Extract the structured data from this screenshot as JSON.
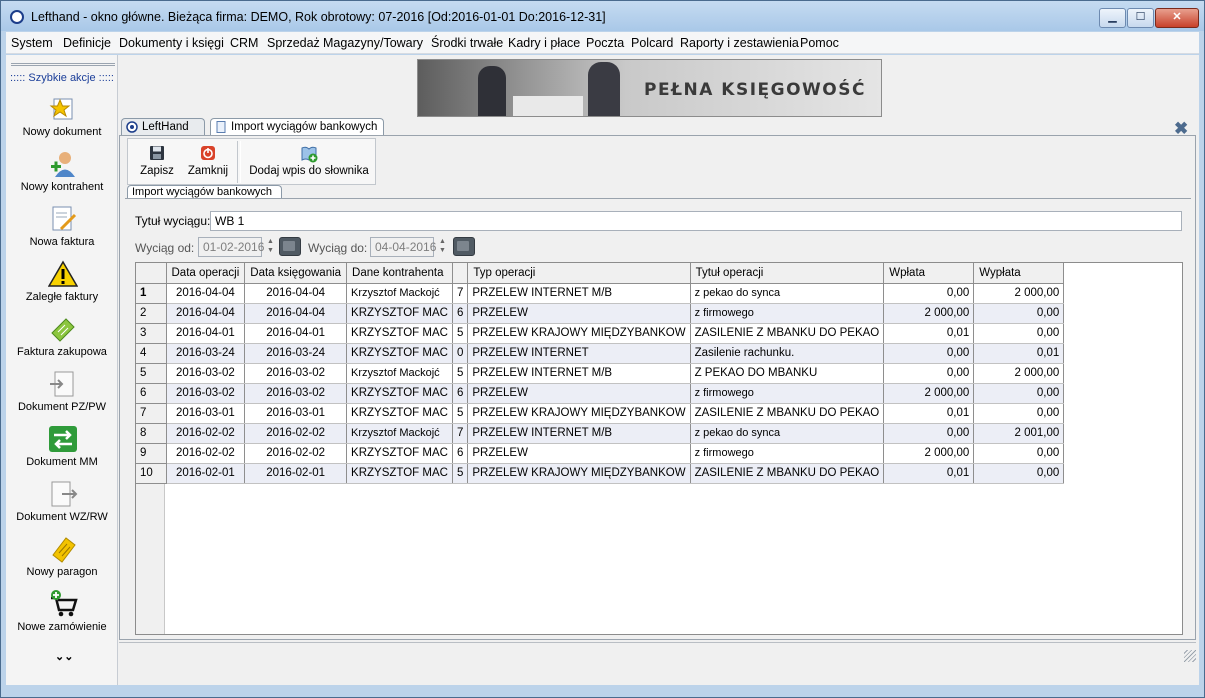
{
  "window": {
    "title": "Lefthand - okno główne. Bieżąca firma: DEMO, Rok obrotowy: 07-2016 [Od:2016-01-01 Do:2016-12-31]",
    "buttons": {
      "minimize": "▁",
      "maximize": "☐",
      "close": "✕"
    }
  },
  "menu": [
    "System",
    "Definicje",
    "Dokumenty i księgi",
    "CRM",
    "Sprzedaż",
    "Magazyny/Towary",
    "Środki trwałe",
    "Kadry i płace",
    "Poczta",
    "Polcard",
    "Raporty i zestawienia",
    "Pomoc"
  ],
  "sidebar": {
    "header": "::::: Szybkie akcje :::::",
    "items": [
      {
        "label": "Nowy dokument",
        "icon": "star-document-icon"
      },
      {
        "label": "Nowy kontrahent",
        "icon": "person-add-icon"
      },
      {
        "label": "Nowa faktura",
        "icon": "invoice-pencil-icon"
      },
      {
        "label": "Zaległe faktury",
        "icon": "warning-icon"
      },
      {
        "label": "Faktura zakupowa",
        "icon": "purchase-invoice-icon"
      },
      {
        "label": "Dokument PZ/PW",
        "icon": "document-in-icon"
      },
      {
        "label": "Dokument MM",
        "icon": "transfer-arrows-icon"
      },
      {
        "label": "Dokument WZ/RW",
        "icon": "document-out-icon"
      },
      {
        "label": "Nowy paragon",
        "icon": "receipt-icon"
      },
      {
        "label": "Nowe zamówienie",
        "icon": "cart-add-icon"
      }
    ],
    "more": "⌄⌄"
  },
  "banner": {
    "title": "PEŁNA KSIĘGOWOŚĆ"
  },
  "tabs": [
    {
      "label": "LeftHand",
      "icon": "lefthand-logo-icon"
    },
    {
      "label": "Import wyciągów bankowych",
      "icon": "document-icon"
    }
  ],
  "close_tab": "✖",
  "toolbar": {
    "save": "Zapisz",
    "close": "Zamknij",
    "add_dict": "Dodaj wpis do słownika"
  },
  "subtab": "Import wyciągów bankowych",
  "form": {
    "title_label": "Tytuł wyciągu:",
    "title_value": "WB 1",
    "from_label": "Wyciąg od:",
    "from_value": "01-02-2016",
    "to_label": "Wyciąg do:",
    "to_value": "04-04-2016"
  },
  "table": {
    "columns": [
      "",
      "Data operacji",
      "Data księgowania",
      "Dane kontrahenta",
      "",
      "Typ operacji",
      "Tytuł operacji",
      "Wpłata",
      "Wypłata"
    ],
    "rows": [
      [
        "1",
        "2016-04-04",
        "2016-04-04",
        "Krzysztof Mackojć",
        "7",
        "PRZELEW INTERNET M/B",
        "z pekao do synca",
        "0,00",
        "2 000,00"
      ],
      [
        "2",
        "2016-04-04",
        "2016-04-04",
        "KRZYSZTOF MAC",
        "6",
        "PRZELEW",
        "z firmowego",
        "2 000,00",
        "0,00"
      ],
      [
        "3",
        "2016-04-01",
        "2016-04-01",
        "KRZYSZTOF MAC",
        "5",
        "PRZELEW KRAJOWY MIĘDZYBANKOW",
        "ZASILENIE Z MBANKU DO PEKAO",
        "0,01",
        "0,00"
      ],
      [
        "4",
        "2016-03-24",
        "2016-03-24",
        "KRZYSZTOF MAC",
        "0",
        "PRZELEW INTERNET",
        "Zasilenie rachunku.",
        "0,00",
        "0,01"
      ],
      [
        "5",
        "2016-03-02",
        "2016-03-02",
        "Krzysztof Mackojć",
        "5",
        "PRZELEW INTERNET M/B",
        "Z PEKAO DO MBANKU",
        "0,00",
        "2 000,00"
      ],
      [
        "6",
        "2016-03-02",
        "2016-03-02",
        "KRZYSZTOF MAC",
        "6",
        "PRZELEW",
        "z firmowego",
        "2 000,00",
        "0,00"
      ],
      [
        "7",
        "2016-03-01",
        "2016-03-01",
        "KRZYSZTOF MAC",
        "5",
        "PRZELEW KRAJOWY MIĘDZYBANKOW",
        "ZASILENIE Z MBANKU DO PEKAO",
        "0,01",
        "0,00"
      ],
      [
        "8",
        "2016-02-02",
        "2016-02-02",
        "Krzysztof Mackojć",
        "7",
        "PRZELEW INTERNET M/B",
        "z pekao do synca",
        "0,00",
        "2 001,00"
      ],
      [
        "9",
        "2016-02-02",
        "2016-02-02",
        "KRZYSZTOF MAC",
        "6",
        "PRZELEW",
        "z firmowego",
        "2 000,00",
        "0,00"
      ],
      [
        "10",
        "2016-02-01",
        "2016-02-01",
        "KRZYSZTOF MAC",
        "5",
        "PRZELEW KRAJOWY MIĘDZYBANKOW",
        "ZASILENIE Z MBANKU DO PEKAO",
        "0,01",
        "0,00"
      ]
    ]
  },
  "colors": {
    "title_bar": "#c5dbf1",
    "accent": "#1b3e99",
    "alt_row": "#eceef6"
  }
}
